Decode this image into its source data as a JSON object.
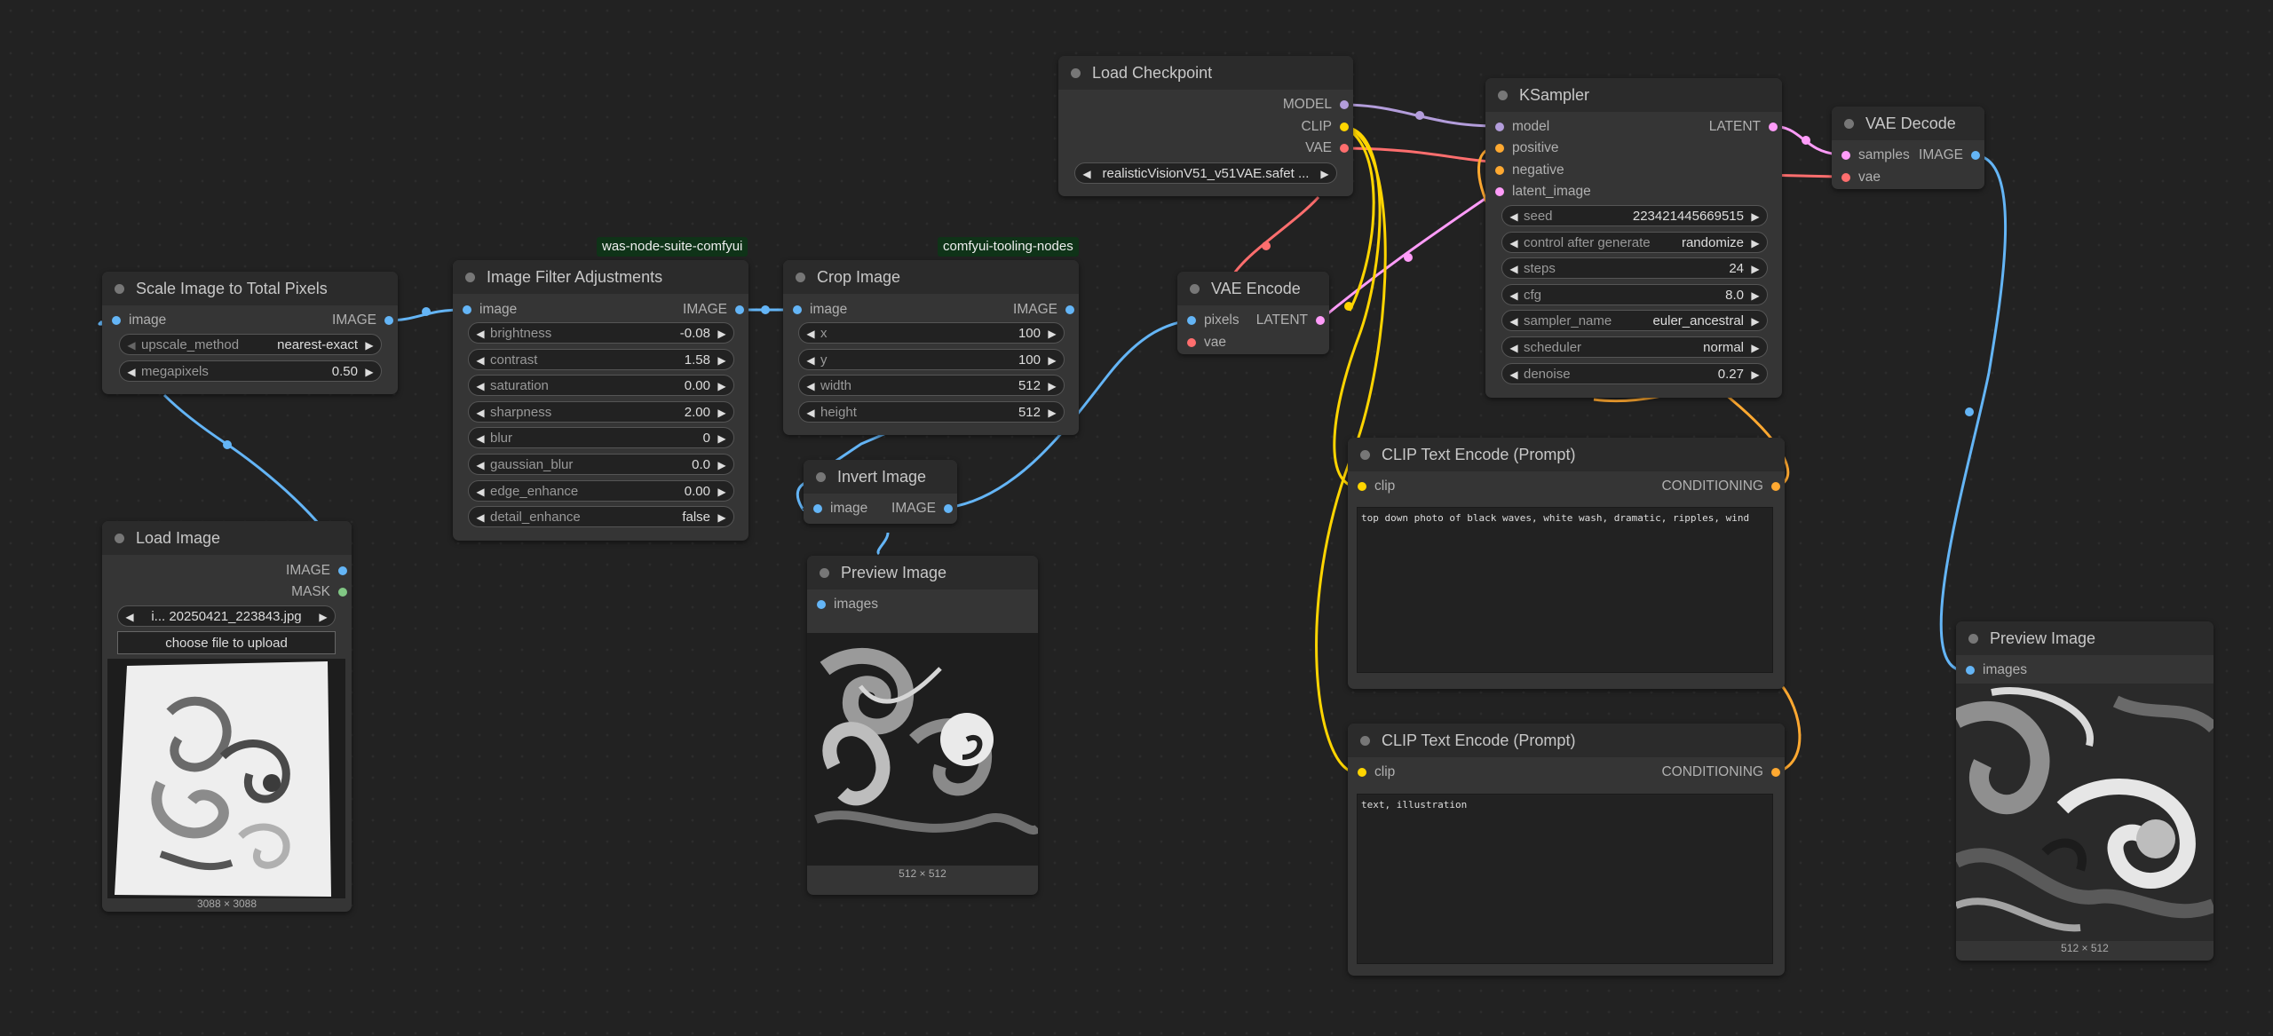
{
  "badges": {
    "filter": "was-node-suite-comfyui",
    "crop": "comfyui-tooling-nodes"
  },
  "scale": {
    "title": "Scale Image to Total Pixels",
    "in_image": "image",
    "out_image": "IMAGE",
    "upscale_label": "upscale_method",
    "upscale_value": "nearest-exact",
    "mp_label": "megapixels",
    "mp_value": "0.50"
  },
  "filter": {
    "title": "Image Filter Adjustments",
    "in_image": "image",
    "out_image": "IMAGE",
    "widgets": [
      {
        "label": "brightness",
        "value": "-0.08"
      },
      {
        "label": "contrast",
        "value": "1.58"
      },
      {
        "label": "saturation",
        "value": "0.00"
      },
      {
        "label": "sharpness",
        "value": "2.00"
      },
      {
        "label": "blur",
        "value": "0"
      },
      {
        "label": "gaussian_blur",
        "value": "0.0"
      },
      {
        "label": "edge_enhance",
        "value": "0.00"
      },
      {
        "label": "detail_enhance",
        "value": "false"
      }
    ]
  },
  "crop": {
    "title": "Crop Image",
    "in_image": "image",
    "out_image": "IMAGE",
    "widgets": [
      {
        "label": "x",
        "value": "100"
      },
      {
        "label": "y",
        "value": "100"
      },
      {
        "label": "width",
        "value": "512"
      },
      {
        "label": "height",
        "value": "512"
      }
    ]
  },
  "invert": {
    "title": "Invert Image",
    "in_image": "image",
    "out_image": "IMAGE"
  },
  "preview1": {
    "title": "Preview Image",
    "in_images": "images",
    "dims": "512 × 512"
  },
  "load_image": {
    "title": "Load Image",
    "out_image": "IMAGE",
    "out_mask": "MASK",
    "file_value": "i... 20250421_223843.jpg",
    "upload_label": "choose file to upload",
    "dims": "3088 × 3088"
  },
  "checkpoint": {
    "title": "Load Checkpoint",
    "out_model": "MODEL",
    "out_clip": "CLIP",
    "out_vae": "VAE",
    "ckpt_value": "realisticVisionV51_v51VAE.safet ..."
  },
  "vae_encode": {
    "title": "VAE Encode",
    "in_pixels": "pixels",
    "in_vae": "vae",
    "out_latent": "LATENT"
  },
  "ksampler": {
    "title": "KSampler",
    "in_model": "model",
    "in_positive": "positive",
    "in_negative": "negative",
    "in_latent": "latent_image",
    "out_latent": "LATENT",
    "widgets": [
      {
        "label": "seed",
        "value": "223421445669515"
      },
      {
        "label": "control after generate",
        "value": "randomize"
      },
      {
        "label": "steps",
        "value": "24"
      },
      {
        "label": "cfg",
        "value": "8.0"
      },
      {
        "label": "sampler_name",
        "value": "euler_ancestral"
      },
      {
        "label": "scheduler",
        "value": "normal"
      },
      {
        "label": "denoise",
        "value": "0.27"
      }
    ]
  },
  "vae_decode": {
    "title": "VAE Decode",
    "in_samples": "samples",
    "in_vae": "vae",
    "out_image": "IMAGE"
  },
  "clip_pos": {
    "title": "CLIP Text Encode (Prompt)",
    "in_clip": "clip",
    "out_cond": "CONDITIONING",
    "text": "top down photo of black waves, white wash, dramatic, ripples, wind"
  },
  "clip_neg": {
    "title": "CLIP Text Encode (Prompt)",
    "in_clip": "clip",
    "out_cond": "CONDITIONING",
    "text": "text, illustration"
  },
  "preview2": {
    "title": "Preview Image",
    "in_images": "images",
    "dims": "512 × 512"
  },
  "colors": {
    "image": "#64b5f6",
    "clip": "#ffd500",
    "vae": "#ff6e6e",
    "model": "#b39ddb",
    "latent": "#ff9cf9",
    "conditioning": "#ffa931",
    "mask": "#81c784"
  }
}
